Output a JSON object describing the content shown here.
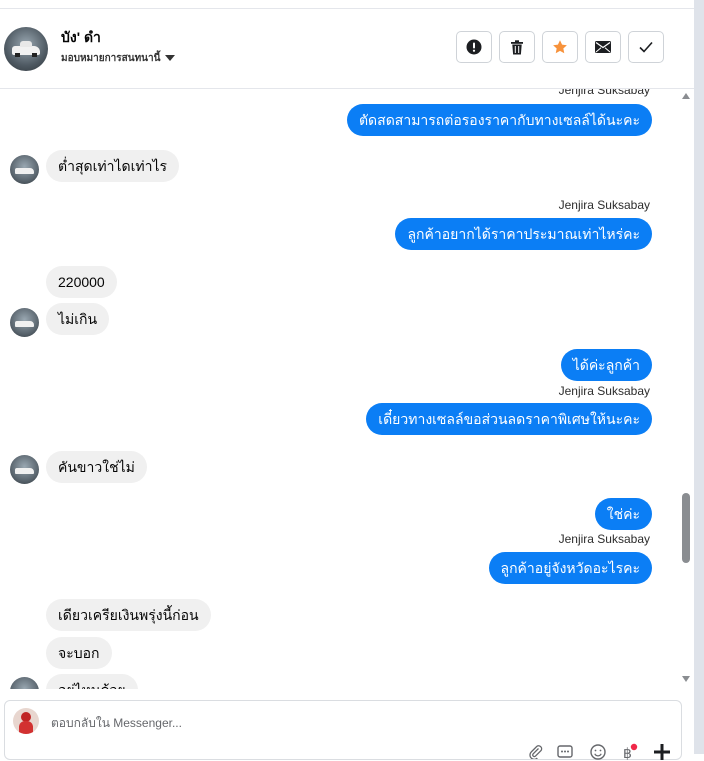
{
  "header": {
    "contact_name": "บัง' ดำ",
    "assign_label": "มอบหมายการสนทนานี้",
    "actions": [
      {
        "name": "spam-button",
        "icon": "alert-circle-icon"
      },
      {
        "name": "delete-button",
        "icon": "trash-icon"
      },
      {
        "name": "star-button",
        "icon": "star-icon",
        "color": "#f7923b"
      },
      {
        "name": "mark-unread-button",
        "icon": "envelope-icon"
      },
      {
        "name": "mark-done-button",
        "icon": "check-icon"
      }
    ]
  },
  "messages": [
    {
      "side": "out",
      "sender": "Jenjira Suksabay",
      "text": "ตัดสดสามารถต่อรองราคากับทางเซลล์ได้นะคะ"
    },
    {
      "side": "in",
      "text": "ต่ำสุดเท่าไดเท่าไร"
    },
    {
      "side": "out",
      "sender": "Jenjira Suksabay",
      "text": "ลูกค้าอยากได้ราคาประมาณเท่าไหร่คะ"
    },
    {
      "side": "in",
      "text": "220000"
    },
    {
      "side": "in",
      "text": "ไม่เกิน"
    },
    {
      "side": "out",
      "text": "ได้ค่ะลูกค้า"
    },
    {
      "side": "out",
      "sender": "Jenjira Suksabay",
      "text": "เดี๋ยวทางเซลล์ขอส่วนลดราคาพิเศษให้นะคะ"
    },
    {
      "side": "in",
      "text": "คันขาวใช่ไม่"
    },
    {
      "side": "out",
      "text": "ใช่ค่ะ"
    },
    {
      "side": "out",
      "sender": "Jenjira Suksabay",
      "text": "ลูกค้าอยู่จังหวัดอะไรคะ"
    },
    {
      "side": "in",
      "text": "เดียวเครียเงินพรุ่งนี้ก่อน"
    },
    {
      "side": "in",
      "text": "จะบอก"
    },
    {
      "side": "in",
      "text": "อยู่ไหนด้วย"
    }
  ],
  "composer": {
    "placeholder": "ตอบกลับใน Messenger...",
    "tools": [
      "attachment-icon",
      "saved-replies-icon",
      "emoji-icon",
      "payment-icon",
      "add-icon"
    ]
  },
  "colors": {
    "outgoing_bubble": "#0b7ef5",
    "incoming_bubble": "#f0f0f0",
    "star_active": "#f7923b"
  }
}
